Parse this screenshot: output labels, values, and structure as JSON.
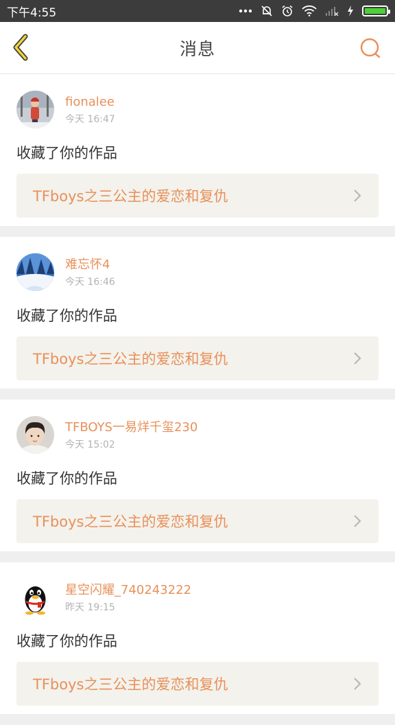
{
  "status_bar": {
    "time": "下午4:55",
    "battery_level": 1.0,
    "icons": [
      "more-dots-icon",
      "mute-icon",
      "alarm-icon",
      "wifi-icon",
      "signal-icon",
      "charging-icon",
      "battery-icon"
    ]
  },
  "header": {
    "title": "消息",
    "back_icon": "chevron-left-icon",
    "search_icon": "search-icon"
  },
  "colors": {
    "accent": "#e8905a",
    "card_link_bg": "#f3f2ec",
    "page_bg": "#efefef"
  },
  "messages": [
    {
      "username": "fionalee",
      "time": "今天 16:47",
      "action": "收藏了你的作品",
      "work_title": "TFboys之三公主的爱恋和复仇",
      "avatar": "snow-girl-avatar"
    },
    {
      "username": "难忘怀4",
      "time": "今天 16:46",
      "action": "收藏了你的作品",
      "work_title": "TFboys之三公主的爱恋和复仇",
      "avatar": "winter-scene-avatar"
    },
    {
      "username": "TFBOYS一易烊千玺230",
      "time": "今天 15:02",
      "action": "收藏了你的作品",
      "work_title": "TFboys之三公主的爱恋和复仇",
      "avatar": "boy-portrait-avatar"
    },
    {
      "username": "星空闪耀_740243222",
      "time": "昨天 19:15",
      "action": "收藏了你的作品",
      "work_title": "TFboys之三公主的爱恋和复仇",
      "avatar": "qq-penguin-avatar"
    }
  ]
}
